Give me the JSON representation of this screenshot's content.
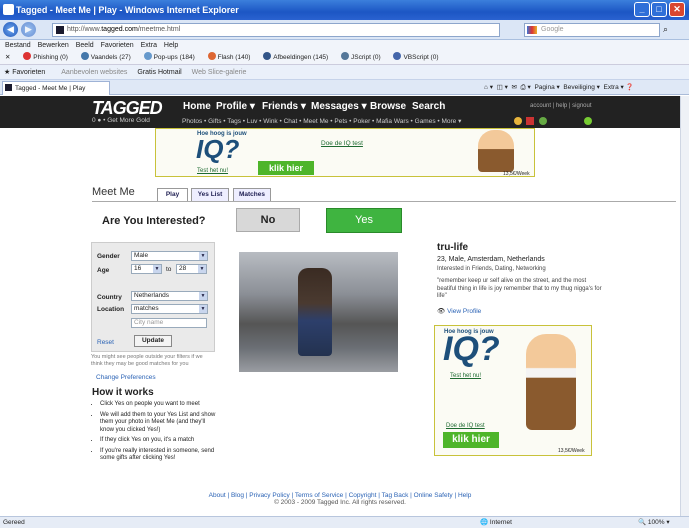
{
  "window": {
    "title": "Tagged - Meet Me | Play - Windows Internet Explorer"
  },
  "browser": {
    "url_prefix": "http://www.",
    "url_domain": "tagged.com",
    "url_suffix": "/meetme.html",
    "search_placeholder": "Google",
    "menu": [
      "Bestand",
      "Bewerken",
      "Beeld",
      "Favorieten",
      "Extra",
      "Help"
    ],
    "links": [
      "Phishing (0)",
      "Vaandels (27)",
      "Pop-ups (184)",
      "Flash (140)",
      "Afbeeldingen (145)",
      "JScript (0)",
      "VBScript (0)"
    ],
    "favorites": {
      "label": "Favorieten",
      "suggested": "Aanbevolen websites",
      "hotmail": "Gratis Hotmail",
      "gallery": "Web Slice-galerie"
    },
    "tab": "Tagged - Meet Me | Play",
    "tools": [
      "Pagina",
      "Beveiliging",
      "Extra"
    ]
  },
  "site": {
    "logo": "TAGGED",
    "nav": [
      "Home",
      "Profile",
      "Friends",
      "Messages",
      "Browse",
      "Search"
    ],
    "account_links": "account | help | signout",
    "gold": "0 ● • Get More Gold",
    "subnav": "Photos • Gifts • Tags • Luv • Wink • Chat • Meet Me • Pets • Poker • Mafia Wars • Games • More ▾"
  },
  "ad_top": {
    "tag": "Hoe hoog is jouw",
    "iq": "IQ?",
    "test": "Test het nu!",
    "do_test": "Doe de IQ test",
    "button": "klik hier",
    "price": "13,5€/Week"
  },
  "page": {
    "title": "Meet Me",
    "tabs": [
      "Play",
      "Yes List",
      "Matches"
    ],
    "question": "Are You Interested?",
    "no": "No",
    "yes": "Yes"
  },
  "filter": {
    "gender_label": "Gender",
    "gender": "Male",
    "age_label": "Age",
    "age_from": "16",
    "age_to_label": "to",
    "age_to": "28",
    "country_label": "Country",
    "country": "Netherlands",
    "location_label": "Location",
    "location": "matches",
    "city_placeholder": "City name",
    "reset": "Reset",
    "update": "Update",
    "note": "You might see people outside your filters if we think they may be good matches for you",
    "change": "Change Preferences"
  },
  "how": {
    "title": "How it works",
    "items": [
      "Click Yes on people you want to meet",
      "We will add them to your Yes List and show them your photo in Meet Me (and they'll know you clicked Yes!)",
      "If they click Yes on you, it's a match",
      "If you're really interested in someone, send some gifts after clicking Yes!"
    ]
  },
  "profile": {
    "name": "tru-life",
    "info": "23, Male, Amsterdam, Netherlands",
    "interest": "Interested in Friends, Dating, Networking",
    "quote": "\"remember keep ur self alive on the street, and the most beatiful thing in life is joy remember that to my thug nigga's for life\"",
    "view": "View Profile"
  },
  "footer": {
    "links": "About | Blog | Privacy Policy | Terms of Service | Copyright | Tag Back | Online Safety | Help",
    "copy": "© 2003 - 2009 Tagged Inc. All rights reserved."
  },
  "status": {
    "left": "Gereed",
    "zone": "Internet",
    "zoom": "100%"
  }
}
